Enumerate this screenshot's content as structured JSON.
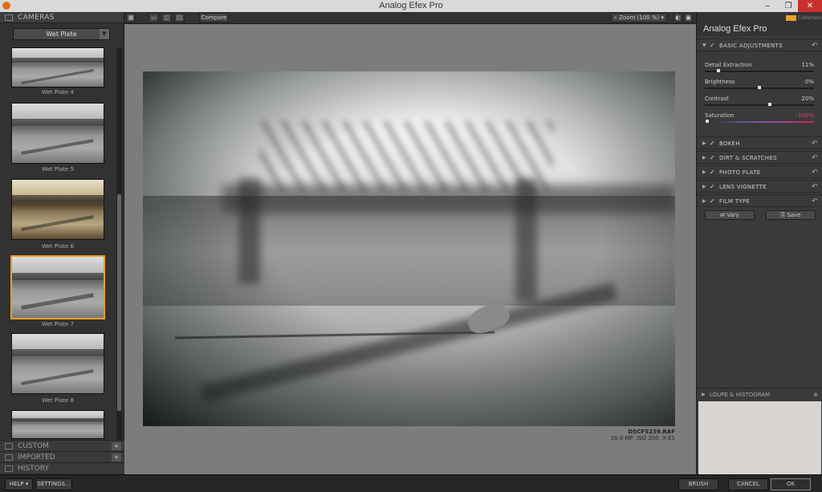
{
  "window": {
    "title": "Analog Efex Pro",
    "min": "–",
    "restore": "❐",
    "close": "✕"
  },
  "left_panel": {
    "header": "CAMERAS",
    "selected_camera": "Wet Plate",
    "thumbnails": [
      {
        "label": "Wet Plate 4"
      },
      {
        "label": "Wet Plate 5"
      },
      {
        "label": "Wet Plate 6"
      },
      {
        "label": "Wet Plate 7"
      },
      {
        "label": "Wet Plate 8"
      }
    ],
    "sections": [
      {
        "label": "CUSTOM",
        "plus": "+"
      },
      {
        "label": "IMPORTED",
        "plus": "+"
      },
      {
        "label": "HISTORY"
      }
    ]
  },
  "toolbar": {
    "compare": "Compare",
    "zoom": "Zoom (100 %)"
  },
  "image_info": {
    "filename": "DSCF5239.RAF",
    "meta": "16.0 MP, ISO 200, X-E1"
  },
  "right_panel": {
    "title": "Analog Efex Pro",
    "collection": "Collection",
    "basic": {
      "label": "BASIC ADJUSTMENTS",
      "sliders": [
        {
          "label": "Detail Extraction",
          "value": "11%",
          "pos": 0.11
        },
        {
          "label": "Brightness",
          "value": "0%",
          "pos": 0.5
        },
        {
          "label": "Contrast",
          "value": "20%",
          "pos": 0.6
        },
        {
          "label": "Saturation",
          "value": "-100%",
          "pos": 0.0
        }
      ]
    },
    "sections": [
      "BOKEH",
      "DIRT & SCRATCHES",
      "PHOTO PLATE",
      "LENS VIGNETTE",
      "FILM TYPE"
    ],
    "vary": "Vary",
    "save": "Save",
    "loupe": "LOUPE & HISTOGRAM"
  },
  "bottom": {
    "help": "HELP ▾",
    "settings": "SETTINGS...",
    "brush": "BRUSH",
    "cancel": "CANCEL",
    "ok": "OK"
  }
}
